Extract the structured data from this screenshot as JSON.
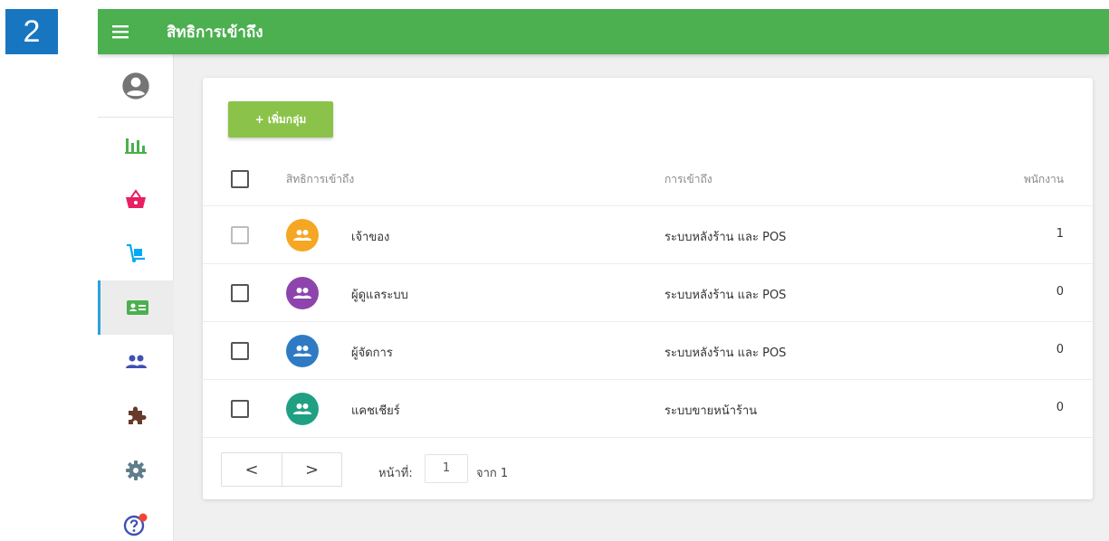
{
  "step_badge": "2",
  "header": {
    "title": "สิทธิการเข้าถึง"
  },
  "sidebar": {
    "items": [
      {
        "icon": "account-circle-icon",
        "color": "#757575"
      },
      {
        "icon": "bar-chart-icon",
        "color": "#4caf50"
      },
      {
        "icon": "basket-icon",
        "color": "#e91e63"
      },
      {
        "icon": "dolly-icon",
        "color": "#03a9f4"
      },
      {
        "icon": "id-card-icon",
        "color": "#4caf50",
        "active": true
      },
      {
        "icon": "people-icon",
        "color": "#3f51b5"
      },
      {
        "icon": "puzzle-icon",
        "color": "#673a2a"
      },
      {
        "icon": "gear-icon",
        "color": "#607d8b"
      },
      {
        "icon": "help-icon",
        "color": "#3f51b5",
        "notification_color": "#f44336"
      }
    ]
  },
  "toolbar": {
    "add_label": "+ เพิ่มกลุ่ม"
  },
  "table": {
    "columns": {
      "name": "สิทธิการเข้าถึง",
      "access": "การเข้าถึง",
      "employees": "พนักงาน"
    },
    "rows": [
      {
        "name": "เจ้าของ",
        "access": "ระบบหลังร้าน และ POS",
        "employees": "1",
        "color": "#f5a623",
        "checkbox_disabled": true
      },
      {
        "name": "ผู้ดูแลระบบ",
        "access": "ระบบหลังร้าน และ POS",
        "employees": "0",
        "color": "#8e44ad",
        "checkbox_disabled": false
      },
      {
        "name": "ผู้จัดการ",
        "access": "ระบบหลังร้าน และ POS",
        "employees": "0",
        "color": "#2e7bc4",
        "checkbox_disabled": false
      },
      {
        "name": "แคชเชียร์",
        "access": "ระบบขายหน้าร้าน",
        "employees": "0",
        "color": "#1fa083",
        "checkbox_disabled": false
      }
    ]
  },
  "pagination": {
    "prev": "<",
    "next": ">",
    "page_label": "หน้าที่:",
    "page_value": "1",
    "of_label": "จาก 1"
  }
}
